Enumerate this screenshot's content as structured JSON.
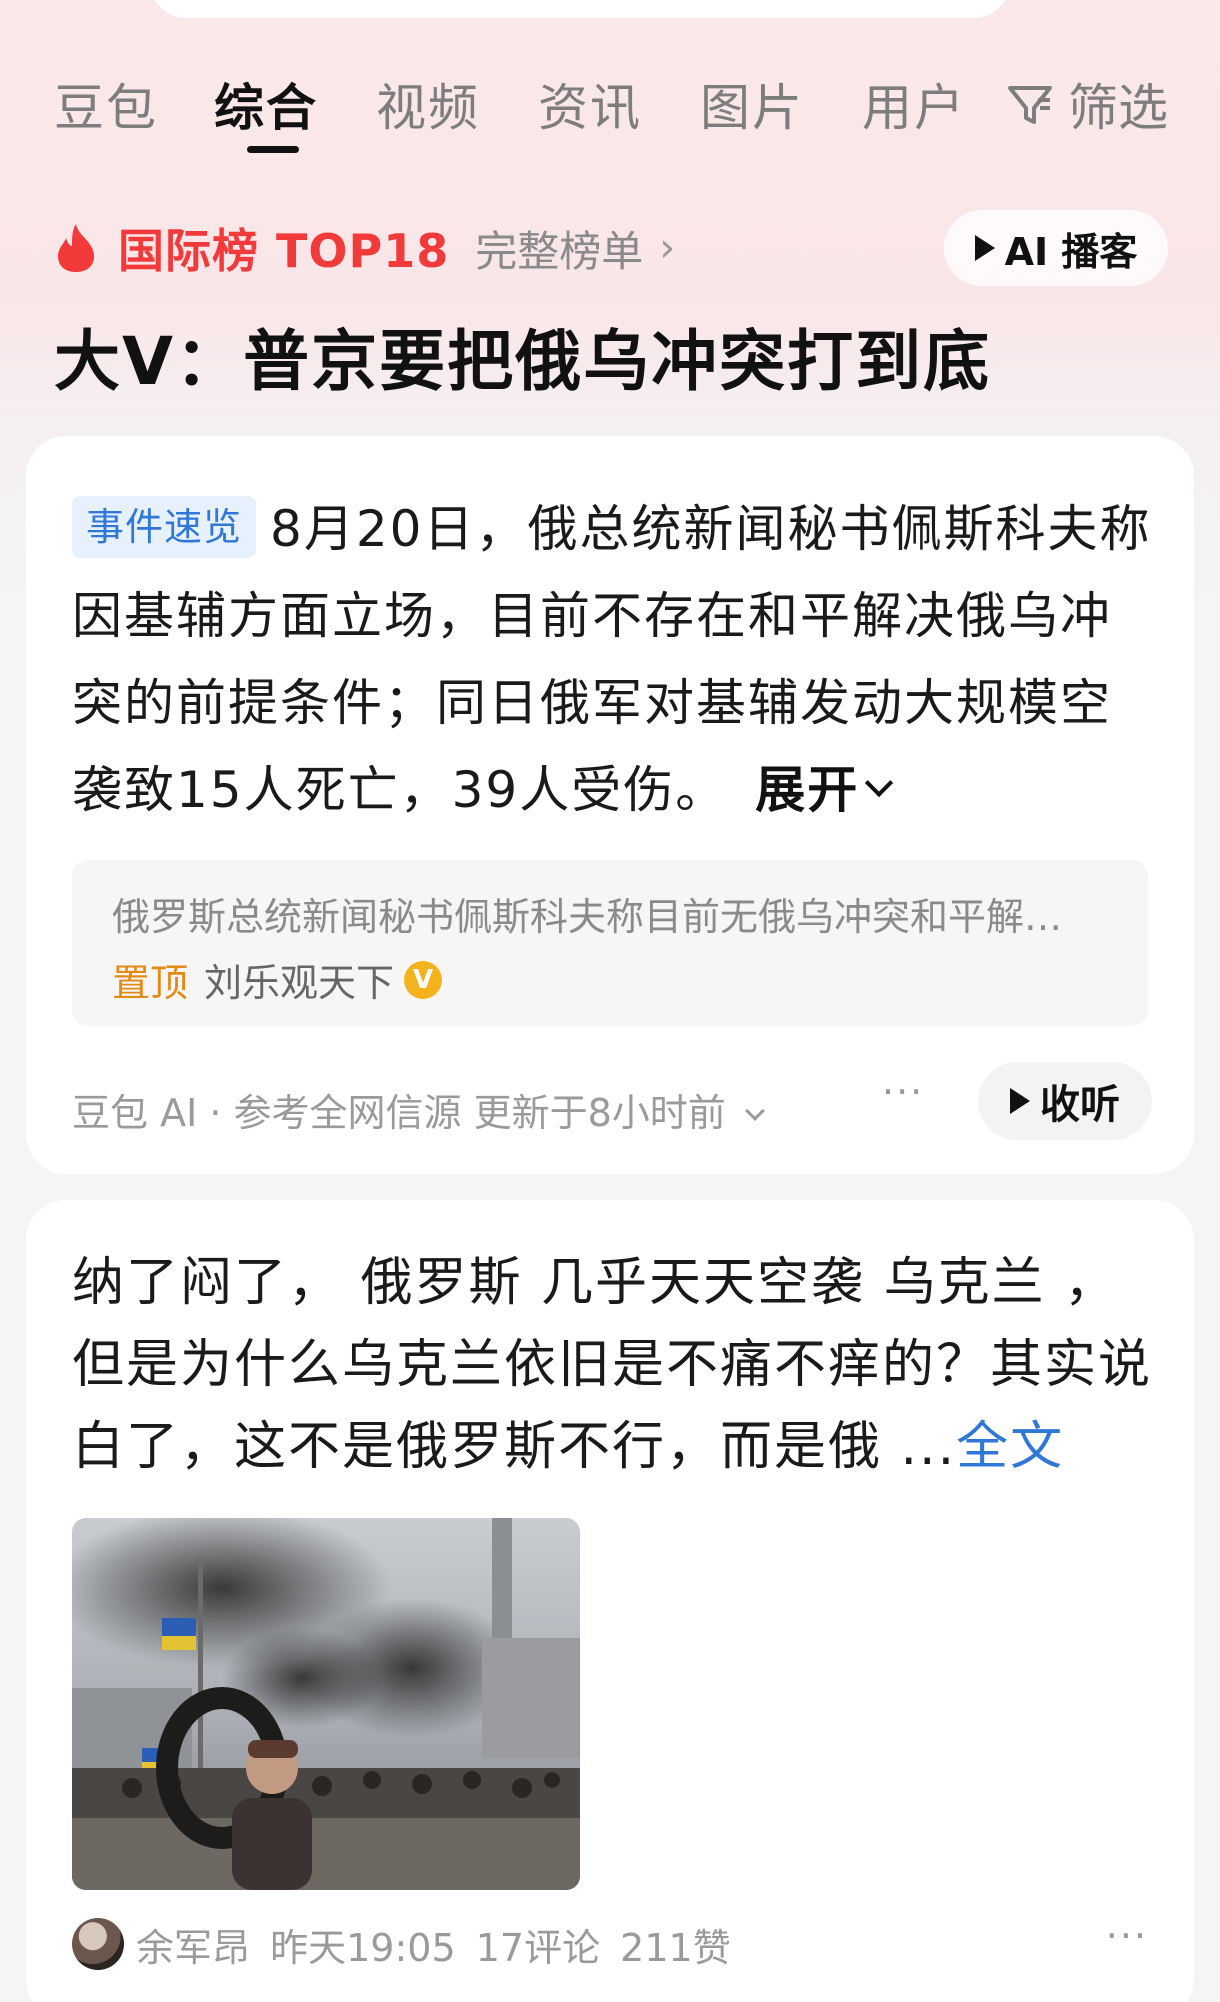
{
  "tabs": [
    {
      "label": "豆包"
    },
    {
      "label": "综合",
      "active": true
    },
    {
      "label": "视频"
    },
    {
      "label": "资讯"
    },
    {
      "label": "图片"
    },
    {
      "label": "用户"
    }
  ],
  "filter_label": "筛选",
  "hot": {
    "title": "国际榜 TOP18",
    "full_list": "完整榜单",
    "chevron": "›",
    "ai_podcast": "AI 播客"
  },
  "headline": "大V：普京要把俄乌冲突打到底",
  "summary_card": {
    "badge": "事件速览",
    "text": "8月20日，俄总统新闻秘书佩斯科夫称因基辅方面立场，目前不存在和平解决俄乌冲突的前提条件；同日俄军对基辅发动大规模空袭致15人死亡，39人受伤。",
    "expand": "展开",
    "quote_text": "俄罗斯总统新闻秘书佩斯科夫称目前无俄乌冲突和平解…",
    "pinned": "置顶",
    "quote_author": "刘乐观天下",
    "verified": "V",
    "source": "豆包 AI · 参考全网信源 更新于8小时前",
    "more": "···",
    "listen": "收听"
  },
  "post_card": {
    "text": "纳了闷了， 俄罗斯 几乎天天空袭 乌克兰 ，但是为什么乌克兰依旧是不痛不痒的？其实说白了，这不是俄罗斯不行，而是俄 ...",
    "full_text": "全文",
    "author": "余军昂",
    "time": "昨天19:05",
    "comments": "17评论",
    "likes": "211赞",
    "more": "···"
  },
  "colors": {
    "accent_red": "#f23a3a",
    "link_blue": "#2f78d8",
    "pin_orange": "#e58a16",
    "verified_gold": "#f4b21f"
  }
}
